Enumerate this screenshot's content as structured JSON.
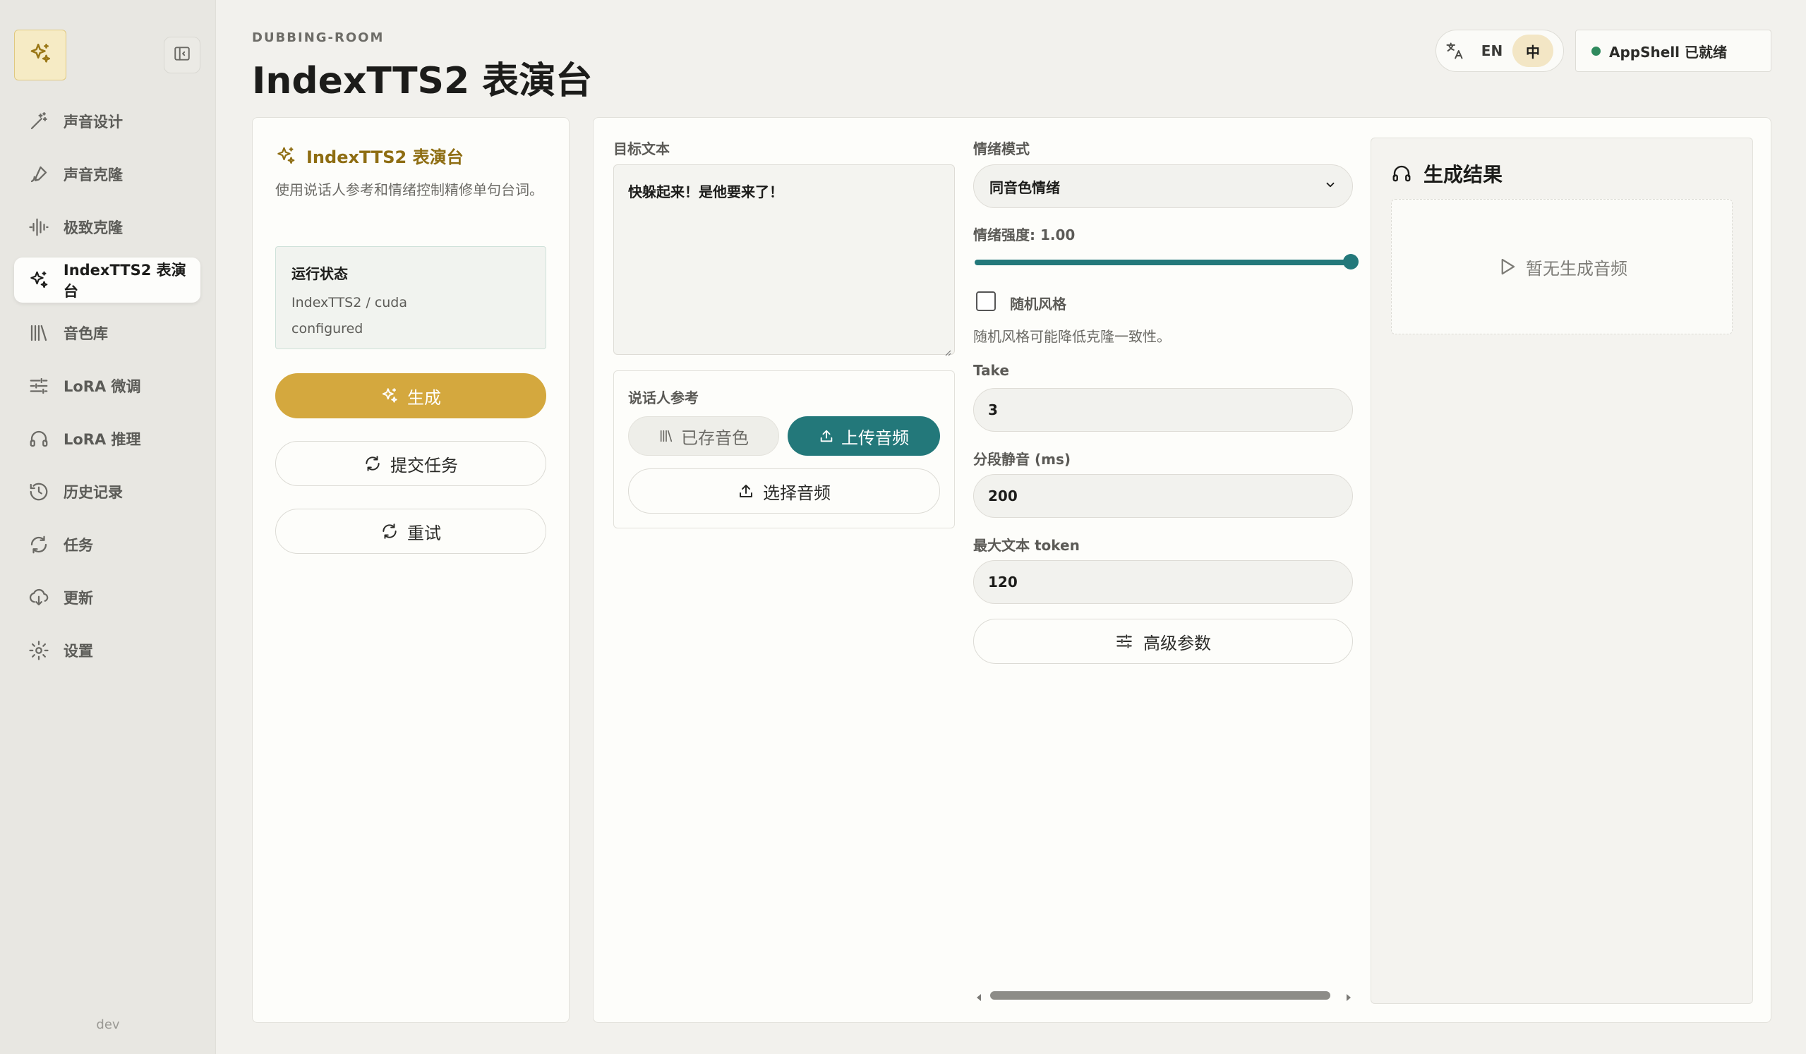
{
  "sidebar": {
    "dev_label": "dev",
    "items": [
      {
        "label": "声音设计",
        "icon": "wand-icon"
      },
      {
        "label": "声音克隆",
        "icon": "brush-icon"
      },
      {
        "label": "极致克隆",
        "icon": "waveform-icon"
      },
      {
        "label": "IndexTTS2 表演台",
        "icon": "sparkles-icon",
        "active": true
      },
      {
        "label": "音色库",
        "icon": "library-icon"
      },
      {
        "label": "LoRA 微调",
        "icon": "sliders-icon"
      },
      {
        "label": "LoRA 推理",
        "icon": "headphones-icon"
      },
      {
        "label": "历史记录",
        "icon": "history-icon"
      },
      {
        "label": "任务",
        "icon": "refresh-icon"
      },
      {
        "label": "更新",
        "icon": "cloud-download-icon"
      },
      {
        "label": "设置",
        "icon": "gear-icon"
      }
    ]
  },
  "header": {
    "eyebrow": "DUBBING-ROOM",
    "title": "IndexTTS2 表演台",
    "lang_en": "EN",
    "lang_zh": "中",
    "status": "AppShell 已就绪"
  },
  "left_panel": {
    "title": "IndexTTS2 表演台",
    "description": "使用说话人参考和情绪控制精修单句台词。",
    "runtime_title": "运行状态",
    "runtime_line1": "IndexTTS2 / cuda",
    "runtime_line2": "configured",
    "generate_label": "生成",
    "submit_label": "提交任务",
    "retry_label": "重试"
  },
  "form": {
    "target_text_label": "目标文本",
    "target_text_value": "快躲起来！是他要来了！",
    "speaker_ref_label": "说话人参考",
    "saved_voice_label": "已存音色",
    "upload_audio_label": "上传音频",
    "select_audio_label": "选择音频",
    "emotion_mode_label": "情绪模式",
    "emotion_mode_value": "同音色情绪",
    "emotion_strength_label": "情绪强度: 1.00",
    "emotion_strength_value": 1.0,
    "random_style_label": "随机风格",
    "random_style_hint": "随机风格可能降低克隆一致性。",
    "take_label": "Take",
    "take_value": "3",
    "segment_silence_label": "分段静音 (ms)",
    "segment_silence_value": "200",
    "max_token_label": "最大文本 token",
    "max_token_value": "120",
    "advanced_label": "高级参数"
  },
  "result": {
    "title": "生成结果",
    "empty": "暂无生成音频"
  },
  "colors": {
    "accent_gold": "#d4a83e",
    "accent_teal": "#23787a",
    "status_green": "#2f8a5e"
  }
}
